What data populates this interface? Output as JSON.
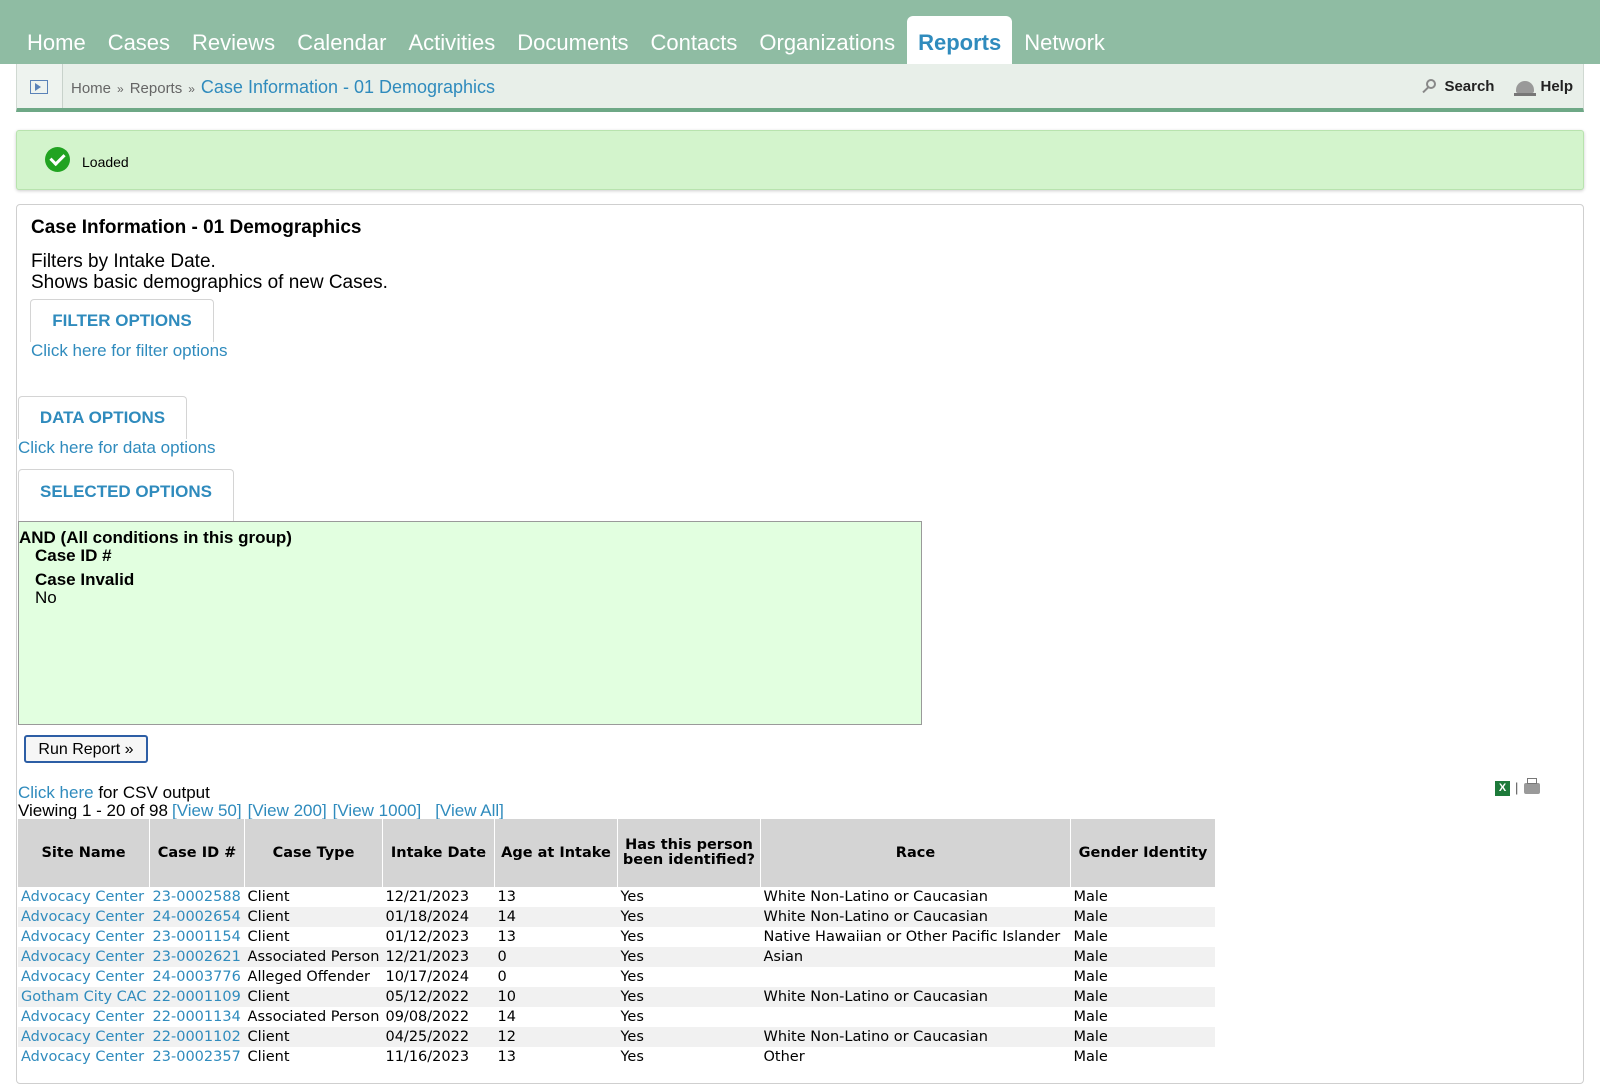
{
  "nav": {
    "tabs": [
      "Home",
      "Cases",
      "Reviews",
      "Calendar",
      "Activities",
      "Documents",
      "Contacts",
      "Organizations",
      "Reports",
      "Network"
    ],
    "active": "Reports"
  },
  "breadcrumb": {
    "home": "Home",
    "reports": "Reports",
    "separator": "»",
    "current": "Case Information - 01 Demographics",
    "search_label": "Search",
    "help_label": "Help"
  },
  "notice": {
    "message": "Loaded"
  },
  "report": {
    "title": "Case Information - 01 Demographics",
    "desc_line1": "Filters by Intake Date.",
    "desc_line2": "Shows basic demographics of new Cases.",
    "filter_tab": "FILTER OPTIONS",
    "filter_link": "Click here for filter options",
    "data_tab": "DATA OPTIONS",
    "data_link": "Click here for data options",
    "selected_tab": "SELECTED OPTIONS",
    "group_label": "AND (All conditions in this group)",
    "cond1": "Case ID #",
    "cond2": "Case Invalid",
    "cond2_value": "No",
    "run_button": "Run Report »",
    "csv_link": "Click here",
    "csv_text": "for CSV output",
    "viewing": "Viewing 1 - 20 of 98",
    "view50": "[View 50]",
    "view200": "[View 200]",
    "view1000": "[View 1000]",
    "viewall": "[View All]",
    "excel_icon": "excel-icon",
    "print_icon": "print-icon"
  },
  "table": {
    "headers": [
      "Site Name",
      "Case ID #",
      "Case Type",
      "Intake Date",
      "Age at Intake",
      "Has this person been identified?",
      "Race",
      "Gender Identity"
    ],
    "rows": [
      [
        "Advocacy Center",
        "23-0002588",
        "Client",
        "12/21/2023",
        "13",
        "Yes",
        "White Non-Latino or Caucasian",
        "Male"
      ],
      [
        "Advocacy Center",
        "24-0002654",
        "Client",
        "01/18/2024",
        "14",
        "Yes",
        "White Non-Latino or Caucasian",
        "Male"
      ],
      [
        "Advocacy Center",
        "23-0001154",
        "Client",
        "01/12/2023",
        "13",
        "Yes",
        "Native Hawaiian or Other Pacific Islander",
        "Male"
      ],
      [
        "Advocacy Center",
        "23-0002621",
        "Associated Person",
        "12/21/2023",
        "0",
        "Yes",
        "Asian",
        "Male"
      ],
      [
        "Advocacy Center",
        "24-0003776",
        "Alleged Offender",
        "10/17/2024",
        "0",
        "Yes",
        "",
        "Male"
      ],
      [
        "Gotham City CAC",
        "22-0001109",
        "Client",
        "05/12/2022",
        "10",
        "Yes",
        "White Non-Latino or Caucasian",
        "Male"
      ],
      [
        "Advocacy Center",
        "22-0001134",
        "Associated Person",
        "09/08/2022",
        "14",
        "Yes",
        "",
        "Male"
      ],
      [
        "Advocacy Center",
        "22-0001102",
        "Client",
        "04/25/2022",
        "12",
        "Yes",
        "White Non-Latino or Caucasian",
        "Male"
      ],
      [
        "Advocacy Center",
        "23-0002357",
        "Client",
        "11/16/2023",
        "13",
        "Yes",
        "Other",
        "Male"
      ]
    ]
  }
}
